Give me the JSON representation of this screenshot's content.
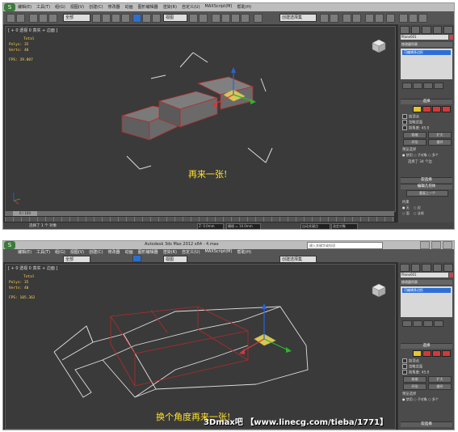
{
  "shot1": {
    "menu": [
      "编辑(E)",
      "工具(T)",
      "组(G)",
      "视图(V)",
      "创建(C)",
      "修改器",
      "动画",
      "图形编辑器",
      "渲染(R)",
      "自定义(U)",
      "MAXScript(M)",
      "帮助(H)"
    ],
    "toolbar": {
      "selection_filter": "全部",
      "ref_coord": "视图",
      "named_selection": "创建选择集"
    },
    "viewport": {
      "label": "[ + 0 透视 0 真实 + 边面 ]",
      "stats": {
        "total_label": "Total",
        "polys": "Polys:  35",
        "verts": "Verts:  40",
        "fps": "FPS:   39.807"
      },
      "caption": "再来一张!"
    },
    "cmd_panel": {
      "object_name": "Plane001",
      "modifier_list": "修改器列表",
      "stack_item": "可编辑多边形",
      "rollout_selection": "选择",
      "by_vertex": "按顶点",
      "ignore_backfacing": "忽略背面",
      "by_angle": "按角度:",
      "angle_value": "45.0",
      "shrink": "收缩",
      "grow": "扩大",
      "ring": "环形",
      "loop": "循环",
      "preview_selection": "预览选择",
      "preview_off": "禁用",
      "preview_subobj": "子对象",
      "preview_multi": "多个",
      "selected_count": "选择了 34 个边",
      "rollout_soft": "软选择",
      "rollout_edit_geometry": "编辑几何体",
      "repeat_last": "重复上一个",
      "constraints": "约束",
      "c_none": "无",
      "c_edge": "边",
      "c_face": "面",
      "c_normal": "法线"
    },
    "time": {
      "frame": "0 / 100"
    },
    "status": {
      "text": "选择了 1 个 对象",
      "z_field": "Z: 0.0mm",
      "grid": "栅格 = 10.0mm",
      "autokey": "自动关键点",
      "selected": "选定对象"
    }
  },
  "shot2": {
    "menu": [
      "编辑(E)",
      "工具(T)",
      "组(G)",
      "视图(V)",
      "创建(C)",
      "修改器",
      "动画",
      "图形编辑器",
      "渲染(R)",
      "自定义(U)",
      "MAXScript(M)",
      "帮助(H)"
    ],
    "title": "Autodesk 3ds Max  2012 x64      - 4.max",
    "search_placeholder": "键入关键字或短语",
    "toolbar": {
      "selection_filter": "全部",
      "ref_coord": "视图",
      "named_selection": "创建选择集"
    },
    "viewport": {
      "label": "[ + 0 透视 0 真实 + 边面 ]",
      "stats": {
        "total_label": "Total",
        "polys": "Polys:  35",
        "verts": "Verts:  40",
        "fps": "FPS:   105.362"
      },
      "caption": "换个角度再来一张!"
    },
    "cmd_panel": {
      "object_name": "Plane001",
      "modifier_list": "修改器列表",
      "stack_item": "可编辑多边形",
      "rollout_selection": "选择",
      "by_vertex": "按顶点",
      "ignore_backfacing": "忽略背面",
      "by_angle": "按角度:",
      "angle_value": "45.0",
      "shrink": "收缩",
      "grow": "扩大",
      "ring": "环形",
      "loop": "循环",
      "preview_selection": "预览选择",
      "preview_off": "禁用",
      "preview_subobj": "子对象",
      "preview_multi": "多个",
      "rollout_soft": "软选择"
    },
    "watermark": "3Dmax吧 【www.linecg.com/tieba/1771】"
  },
  "colors": {
    "caption": "#ffe12a",
    "stats": "#ffd34a",
    "select_red": "#d23a3a",
    "highlight_blue": "#2d6fd6",
    "viewport_bg": "#3a3a3a"
  },
  "icons": [
    "undo-icon",
    "redo-icon",
    "link-icon",
    "select-icon",
    "move-icon",
    "rotate-icon",
    "scale-icon",
    "snap-icon",
    "mirror-icon",
    "align-icon",
    "view-cube-icon"
  ]
}
